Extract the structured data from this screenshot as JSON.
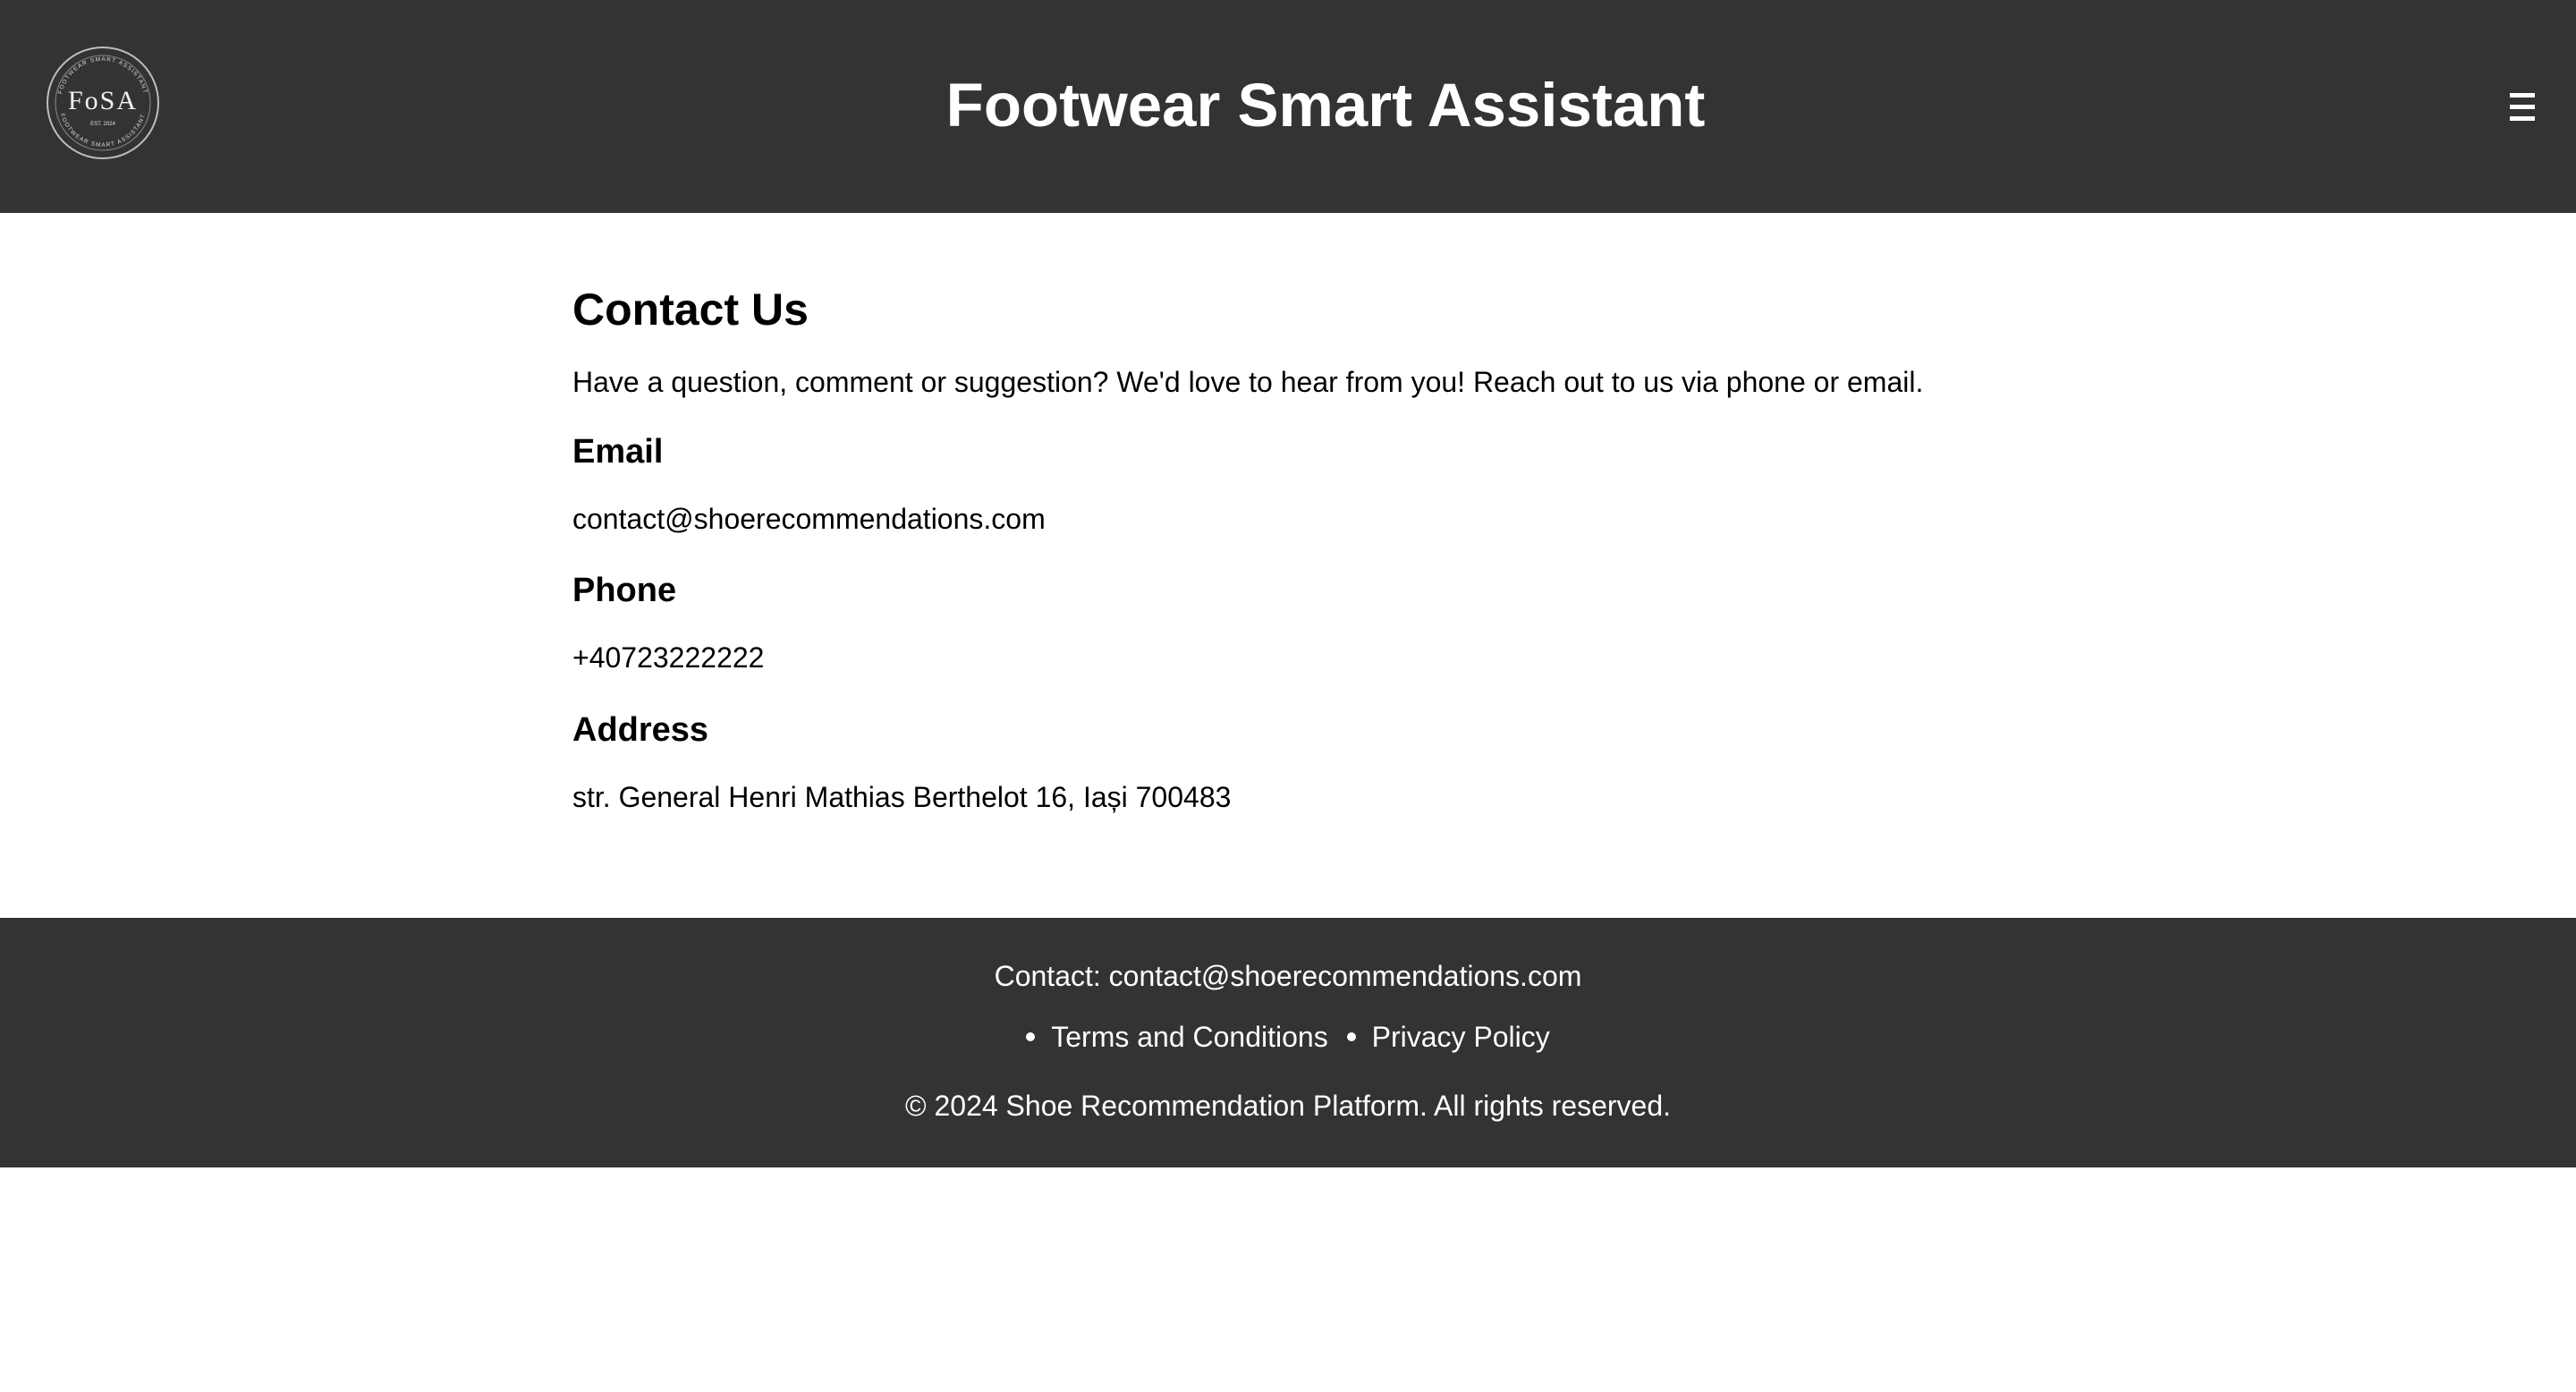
{
  "header": {
    "logo": {
      "text": "FoSA",
      "est": "EST. 2024",
      "ring_text": "FOOTWEAR SMART ASSISTANT"
    },
    "title": "Footwear Smart Assistant",
    "menu_icon": "hamburger-menu-icon"
  },
  "main": {
    "title": "Contact Us",
    "intro": "Have a question, comment or suggestion? We'd love to hear from you! Reach out to us via phone or email.",
    "email": {
      "heading": "Email",
      "value": "contact@shoerecommendations.com"
    },
    "phone": {
      "heading": "Phone",
      "value": "+40723222222"
    },
    "address": {
      "heading": "Address",
      "value": "str. General Henri Mathias Berthelot 16, Iași 700483"
    }
  },
  "footer": {
    "contact": "Contact: contact@shoerecommendations.com",
    "links": [
      "Terms and Conditions",
      "Privacy Policy"
    ],
    "copyright": "© 2024 Shoe Recommendation Platform. All rights reserved."
  },
  "colors": {
    "header_bg": "#333333",
    "footer_bg": "#333333",
    "page_bg": "#ffffff",
    "header_text": "#ffffff",
    "body_text": "#000000"
  }
}
